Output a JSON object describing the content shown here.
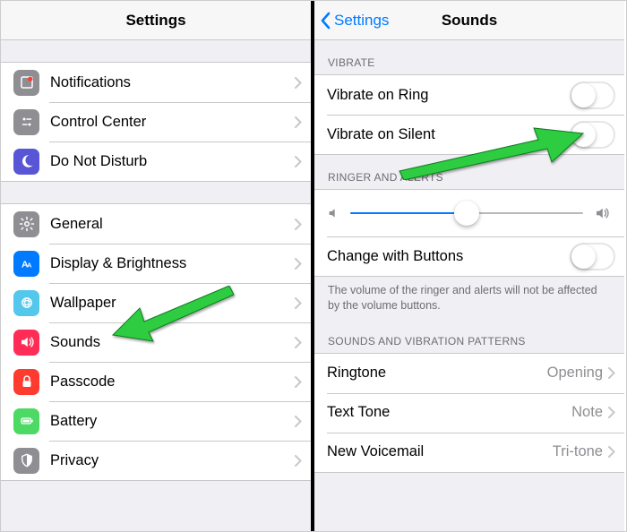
{
  "left": {
    "title": "Settings",
    "group1": [
      {
        "key": "notifications",
        "label": "Notifications"
      },
      {
        "key": "control-center",
        "label": "Control Center"
      },
      {
        "key": "dnd",
        "label": "Do Not Disturb"
      }
    ],
    "group2": [
      {
        "key": "general",
        "label": "General"
      },
      {
        "key": "display",
        "label": "Display & Brightness"
      },
      {
        "key": "wallpaper",
        "label": "Wallpaper"
      },
      {
        "key": "sounds",
        "label": "Sounds"
      },
      {
        "key": "passcode",
        "label": "Passcode"
      },
      {
        "key": "battery",
        "label": "Battery"
      },
      {
        "key": "privacy",
        "label": "Privacy"
      }
    ]
  },
  "right": {
    "back_label": "Settings",
    "title": "Sounds",
    "sections": {
      "vibrate": {
        "header": "VIBRATE",
        "rows": [
          {
            "key": "vibrate-ring",
            "label": "Vibrate on Ring",
            "toggle": false
          },
          {
            "key": "vibrate-silent",
            "label": "Vibrate on Silent",
            "toggle": false
          }
        ]
      },
      "ringer": {
        "header": "RINGER AND ALERTS",
        "slider_value": 0.5,
        "change_buttons": {
          "label": "Change with Buttons",
          "toggle": false
        },
        "footer": "The volume of the ringer and alerts will not be affected by the volume buttons."
      },
      "patterns": {
        "header": "SOUNDS AND VIBRATION PATTERNS",
        "rows": [
          {
            "key": "ringtone",
            "label": "Ringtone",
            "detail": "Opening"
          },
          {
            "key": "text-tone",
            "label": "Text Tone",
            "detail": "Note"
          },
          {
            "key": "new-voicemail",
            "label": "New Voicemail",
            "detail": "Tri-tone"
          }
        ]
      }
    }
  }
}
